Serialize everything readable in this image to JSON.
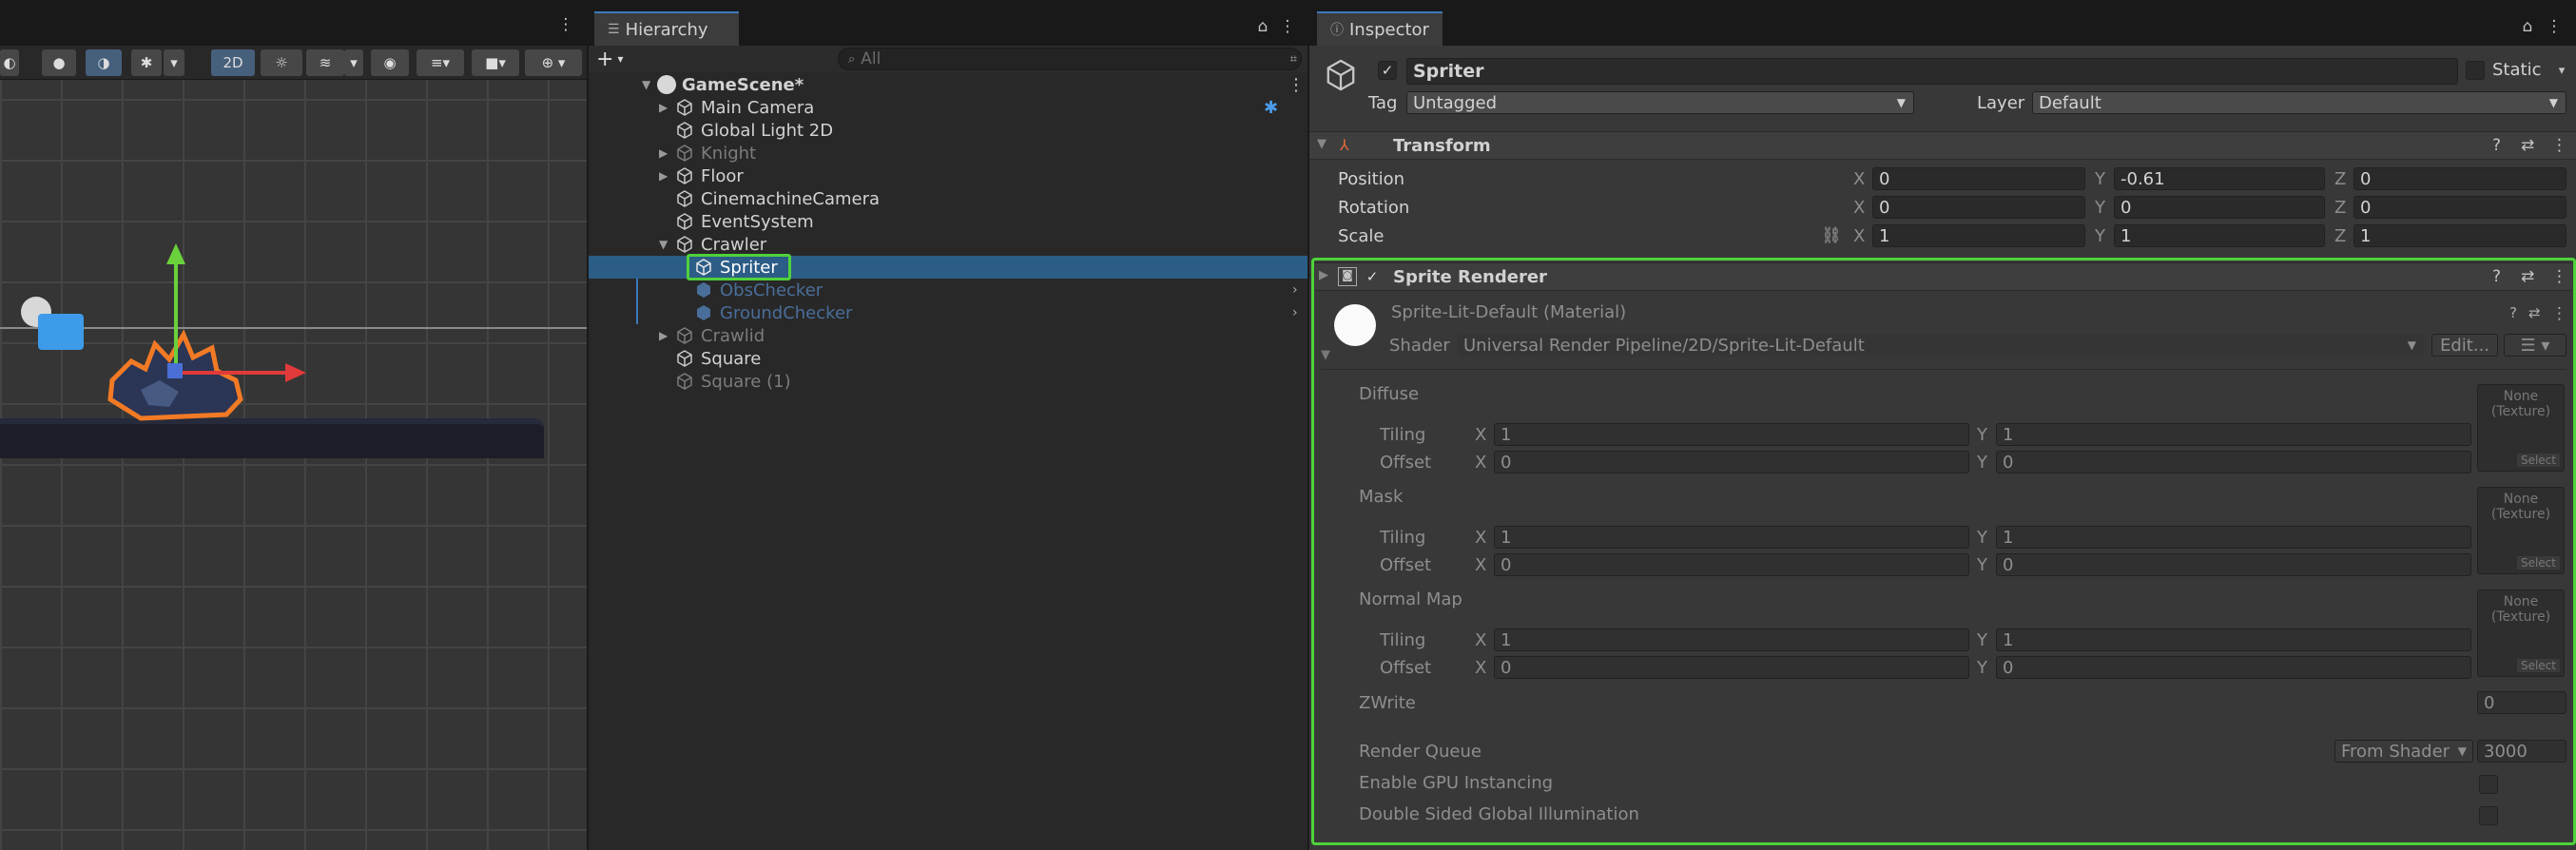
{
  "scene": {
    "toolbar": {
      "mode_2d": "2D"
    }
  },
  "hierarchy": {
    "tab_label": "Hierarchy",
    "search_placeholder": "All",
    "add_label": "+",
    "root": "GameScene*",
    "items": [
      {
        "label": "Main Camera"
      },
      {
        "label": "Global Light 2D"
      },
      {
        "label": "Knight"
      },
      {
        "label": "Floor"
      },
      {
        "label": "CinemachineCamera"
      },
      {
        "label": "EventSystem"
      },
      {
        "label": "Crawler"
      },
      {
        "label": "Spriter"
      },
      {
        "label": "ObsChecker"
      },
      {
        "label": "GroundChecker"
      },
      {
        "label": "Crawlid"
      },
      {
        "label": "Square"
      },
      {
        "label": "Square (1)"
      }
    ]
  },
  "inspector": {
    "tab_label": "Inspector",
    "object_name": "Spriter",
    "static_label": "Static",
    "tag_label": "Tag",
    "tag_value": "Untagged",
    "layer_label": "Layer",
    "layer_value": "Default",
    "transform": {
      "title": "Transform",
      "position_label": "Position",
      "rotation_label": "Rotation",
      "scale_label": "Scale",
      "position": {
        "x": "0",
        "y": "-0.61",
        "z": "0"
      },
      "rotation": {
        "x": "0",
        "y": "0",
        "z": "0"
      },
      "scale": {
        "x": "1",
        "y": "1",
        "z": "1"
      }
    },
    "sprite_renderer": {
      "title": "Sprite Renderer",
      "material_name": "Sprite-Lit-Default (Material)",
      "shader_label": "Shader",
      "shader_value": "Universal Render Pipeline/2D/Sprite-Lit-Default",
      "edit_label": "Edit...",
      "diffuse_label": "Diffuse",
      "mask_label": "Mask",
      "normal_map_label": "Normal Map",
      "tiling_label": "Tiling",
      "offset_label": "Offset",
      "tex_none": "None",
      "tex_type": "(Texture)",
      "tex_select": "Select",
      "diffuse": {
        "tiling_x": "1",
        "tiling_y": "1",
        "offset_x": "0",
        "offset_y": "0"
      },
      "mask": {
        "tiling_x": "1",
        "tiling_y": "1",
        "offset_x": "0",
        "offset_y": "0"
      },
      "normal": {
        "tiling_x": "1",
        "tiling_y": "1",
        "offset_x": "0",
        "offset_y": "0"
      },
      "zwrite_label": "ZWrite",
      "zwrite_value": "0",
      "render_queue_label": "Render Queue",
      "render_queue_mode": "From Shader",
      "render_queue_value": "3000",
      "gpu_instancing_label": "Enable GPU Instancing",
      "double_sided_label": "Double Sided Global Illumination"
    },
    "axis": {
      "x": "X",
      "y": "Y",
      "z": "Z"
    }
  },
  "colors": {
    "highlight": "#4fd23a",
    "selection": "#2c5d87",
    "accent": "#3a79bb"
  }
}
